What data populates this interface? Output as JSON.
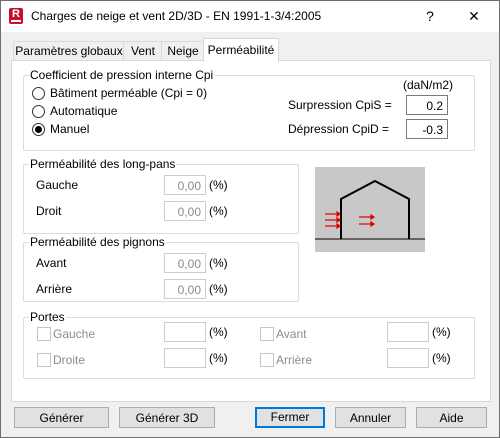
{
  "window": {
    "title": "Charges de neige et vent 2D/3D - EN 1991-1-3/4:2005",
    "help_glyph": "?",
    "close_glyph": "✕",
    "app_icon_letter": "R"
  },
  "tabs": [
    {
      "label": "Paramètres globaux"
    },
    {
      "label": "Vent"
    },
    {
      "label": "Neige"
    },
    {
      "label": "Perméabilité",
      "active": true
    }
  ],
  "cpi": {
    "title": "Coefficient de pression interne Cpi",
    "unit": "(daN/m2)",
    "options": [
      {
        "label": "Bâtiment perméable (Cpi = 0)",
        "selected": false
      },
      {
        "label": "Automatique",
        "selected": false
      },
      {
        "label": "Manuel",
        "selected": true
      }
    ],
    "surpression_label": "Surpression CpiS =",
    "surpression_value": "0.2",
    "depression_label": "Dépression CpiD =",
    "depression_value": "-0.3"
  },
  "long_pans": {
    "title": "Perméabilité des long-pans",
    "gauche_label": "Gauche",
    "gauche_value": "0,00",
    "droit_label": "Droit",
    "droit_value": "0,00",
    "unit": "(%)"
  },
  "pignons": {
    "title": "Perméabilité des pignons",
    "avant_label": "Avant",
    "avant_value": "0,00",
    "arriere_label": "Arrière",
    "arriere_value": "0,00",
    "unit": "(%)"
  },
  "portes": {
    "title": "Portes",
    "gauche_label": "Gauche",
    "droite_label": "Droite",
    "avant_label": "Avant",
    "arriere_label": "Arrière",
    "unit": "(%)"
  },
  "buttons": {
    "generer": "Générer",
    "generer3d": "Générer 3D",
    "fermer": "Fermer",
    "annuler": "Annuler",
    "aide": "Aide"
  },
  "colors": {
    "accent": "#0078d7",
    "brand": "#c8102e",
    "arrow": "#e00000",
    "diagram_bg": "#c8c8c8"
  }
}
